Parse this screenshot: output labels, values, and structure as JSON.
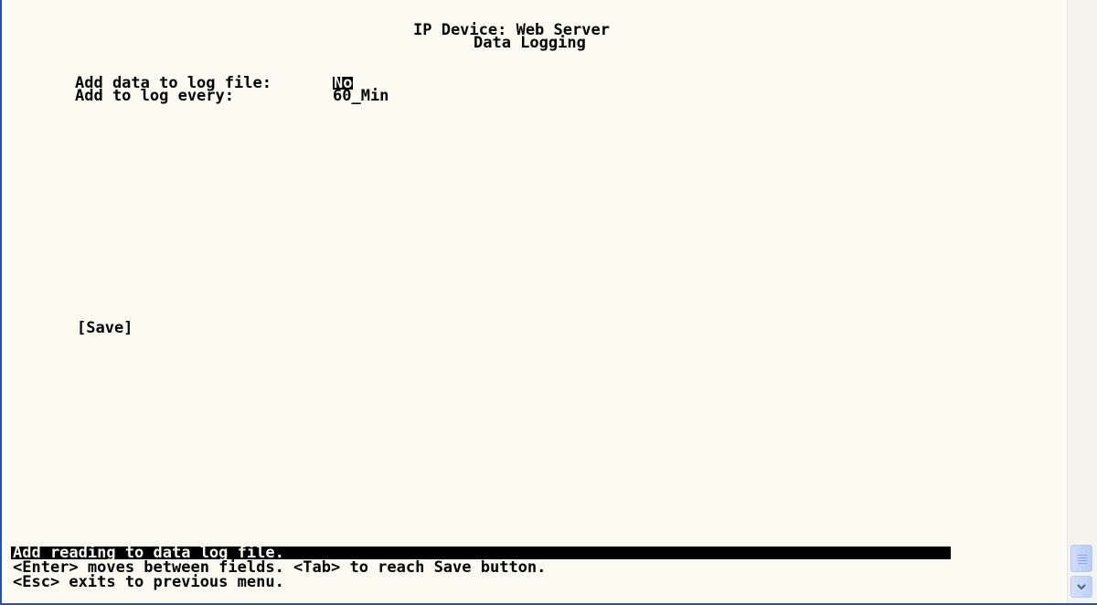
{
  "header": {
    "title": "IP Device: Web Server",
    "subtitle": "Data Logging"
  },
  "fields": [
    {
      "label": "Add data to log file:",
      "value": "No"
    },
    {
      "label": "Add to log every:",
      "value": "60_Min"
    }
  ],
  "buttons": {
    "save_label": "[Save]"
  },
  "status_bar": {
    "help": "Add reading to data log file.",
    "hint_fields": "<Enter> moves between fields. <Tab> to reach Save button.",
    "hint_exit": "<Esc> exits to previous menu."
  },
  "icons": {
    "scroll_down": "chevron-down-icon",
    "scroll_thumb": "scroll-thumb-grip-icon"
  },
  "colors": {
    "background": "#fbfbf2",
    "text": "#000000",
    "highlight_bg": "#000000",
    "window_border": "#2a4fb5"
  }
}
